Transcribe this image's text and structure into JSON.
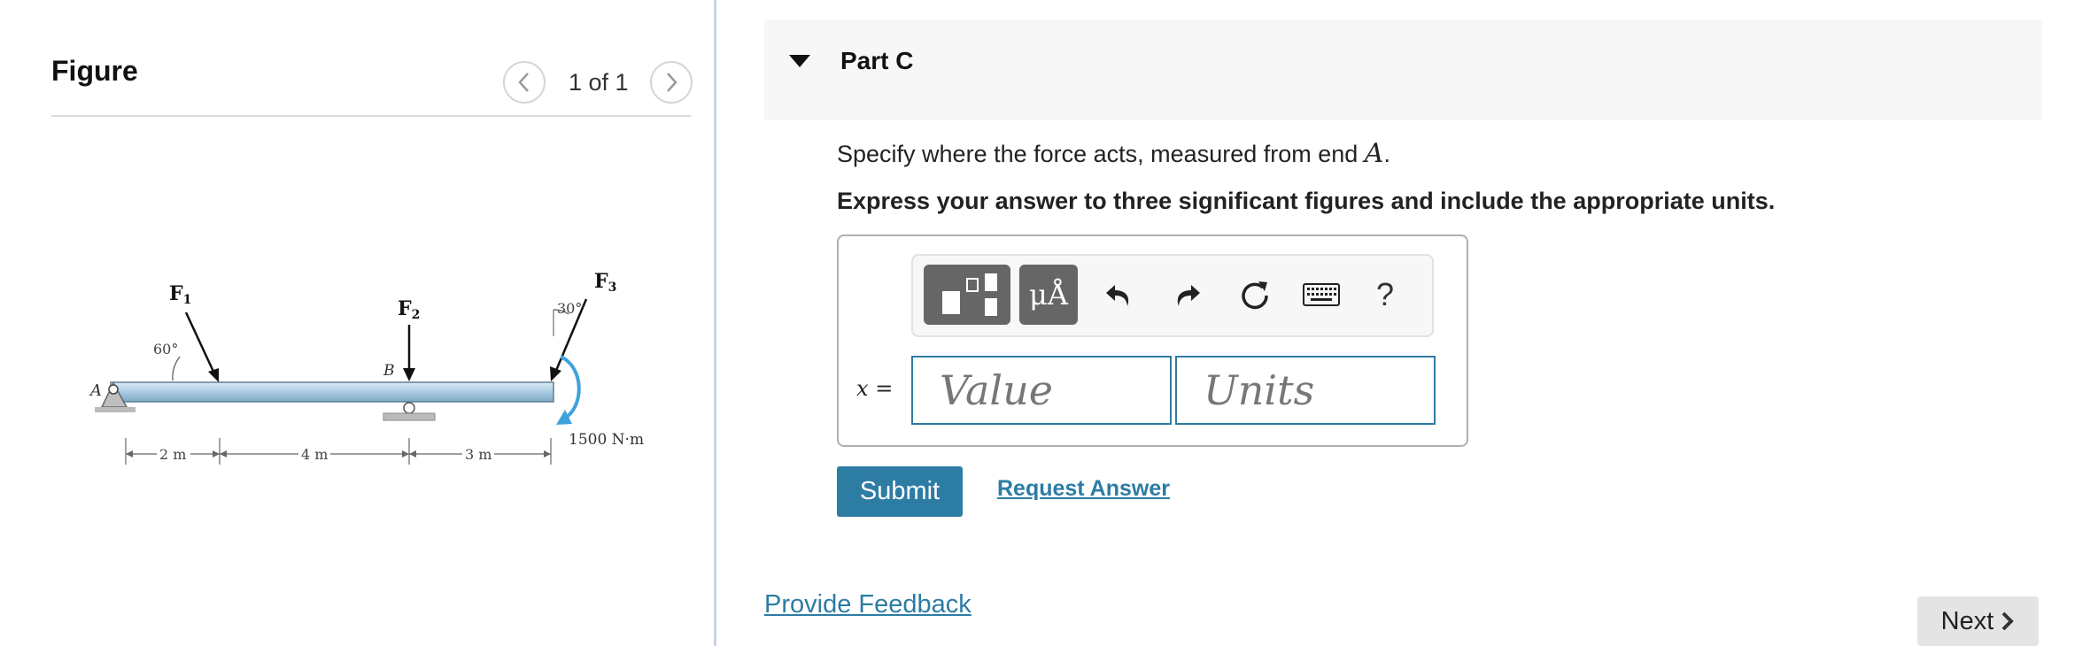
{
  "figure_panel": {
    "title": "Figure",
    "page_indicator": "1 of 1",
    "diagram": {
      "forces": [
        "F1",
        "F2",
        "F3"
      ],
      "angle_f1": "60°",
      "angle_f3": "30°",
      "point_a": "A",
      "point_b": "B",
      "moment": "1500 N·m",
      "distances": [
        "2 m",
        "4 m",
        "3 m"
      ]
    }
  },
  "part": {
    "title": "Part C",
    "prompt_text": "Specify where the force acts, measured from end ",
    "prompt_var": "A",
    "prompt_end": ".",
    "instruction": "Express your answer to three significant figures and include the appropriate units."
  },
  "toolbar": {
    "icons": [
      "templates-icon",
      "units-icon",
      "undo-icon",
      "redo-icon",
      "reset-icon",
      "keyboard-icon",
      "help-icon"
    ],
    "units_label": "μÅ",
    "help_label": "?"
  },
  "answer": {
    "variable": "x",
    "equals": "=",
    "value_placeholder": "Value",
    "units_placeholder": "Units"
  },
  "actions": {
    "submit_label": "Submit",
    "request_answer_label": "Request Answer",
    "feedback_label": "Provide Feedback",
    "next_label": "Next"
  },
  "colors": {
    "accent": "#2d7ca4",
    "moment_arrow": "#3ea3dc",
    "beam": "#bcd8ea"
  }
}
